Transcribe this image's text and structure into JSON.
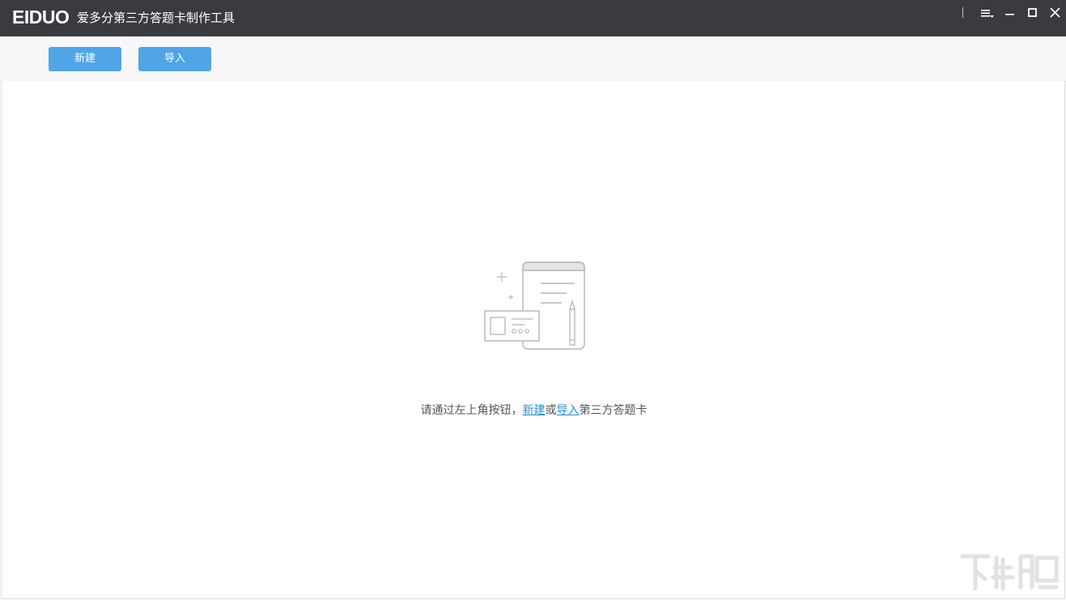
{
  "window": {
    "logo_text": "EIDUO",
    "title": "爱多分第三方答题卡制作工具"
  },
  "toolbar": {
    "new_label": "新建",
    "import_label": "导入"
  },
  "empty_state": {
    "hint_prefix": "请通过左上角按钮，",
    "new_link": "新建",
    "or_text": "或",
    "import_link": "导入",
    "hint_suffix": "第三方答题卡"
  },
  "colors": {
    "titlebar": "#3a3b3f",
    "button": "#4fa5e6",
    "link": "#2a8fd0"
  },
  "icons": [
    "menu-icon",
    "minimize-icon",
    "maximize-icon",
    "close-icon",
    "answer-card-illustration"
  ]
}
